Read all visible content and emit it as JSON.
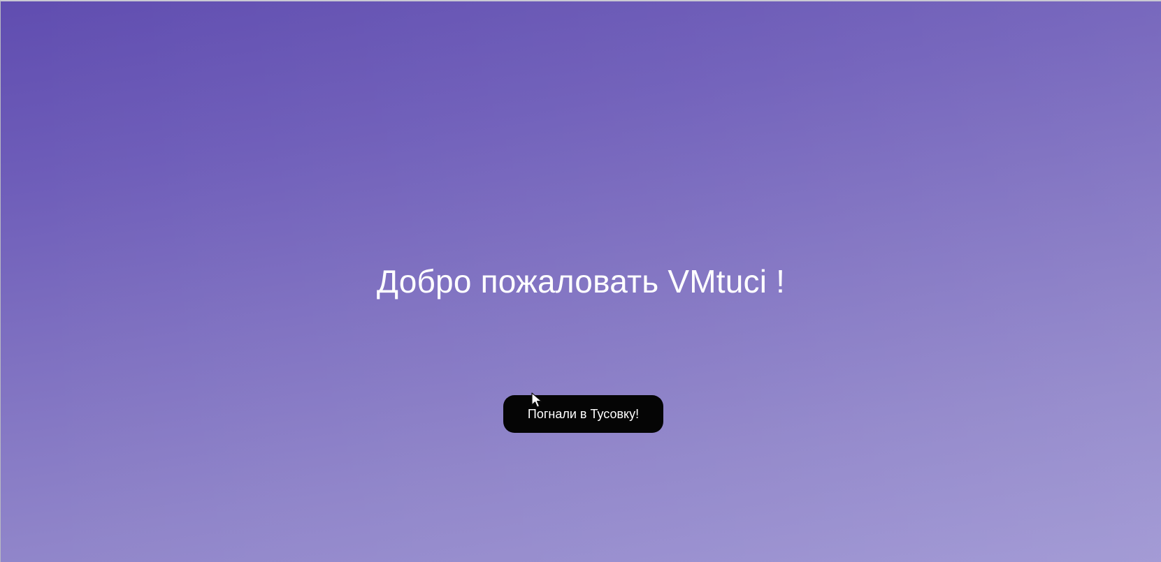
{
  "hero": {
    "title": "Добро пожаловать VMtuci !"
  },
  "cta": {
    "label": "Погнали в Тусовку!"
  },
  "cursor": {
    "icon": "mouse-pointer-icon"
  },
  "colors": {
    "background_top": "#604db0",
    "background_bottom": "#9c93d2",
    "button_background": "#050505",
    "text": "#ffffff"
  }
}
